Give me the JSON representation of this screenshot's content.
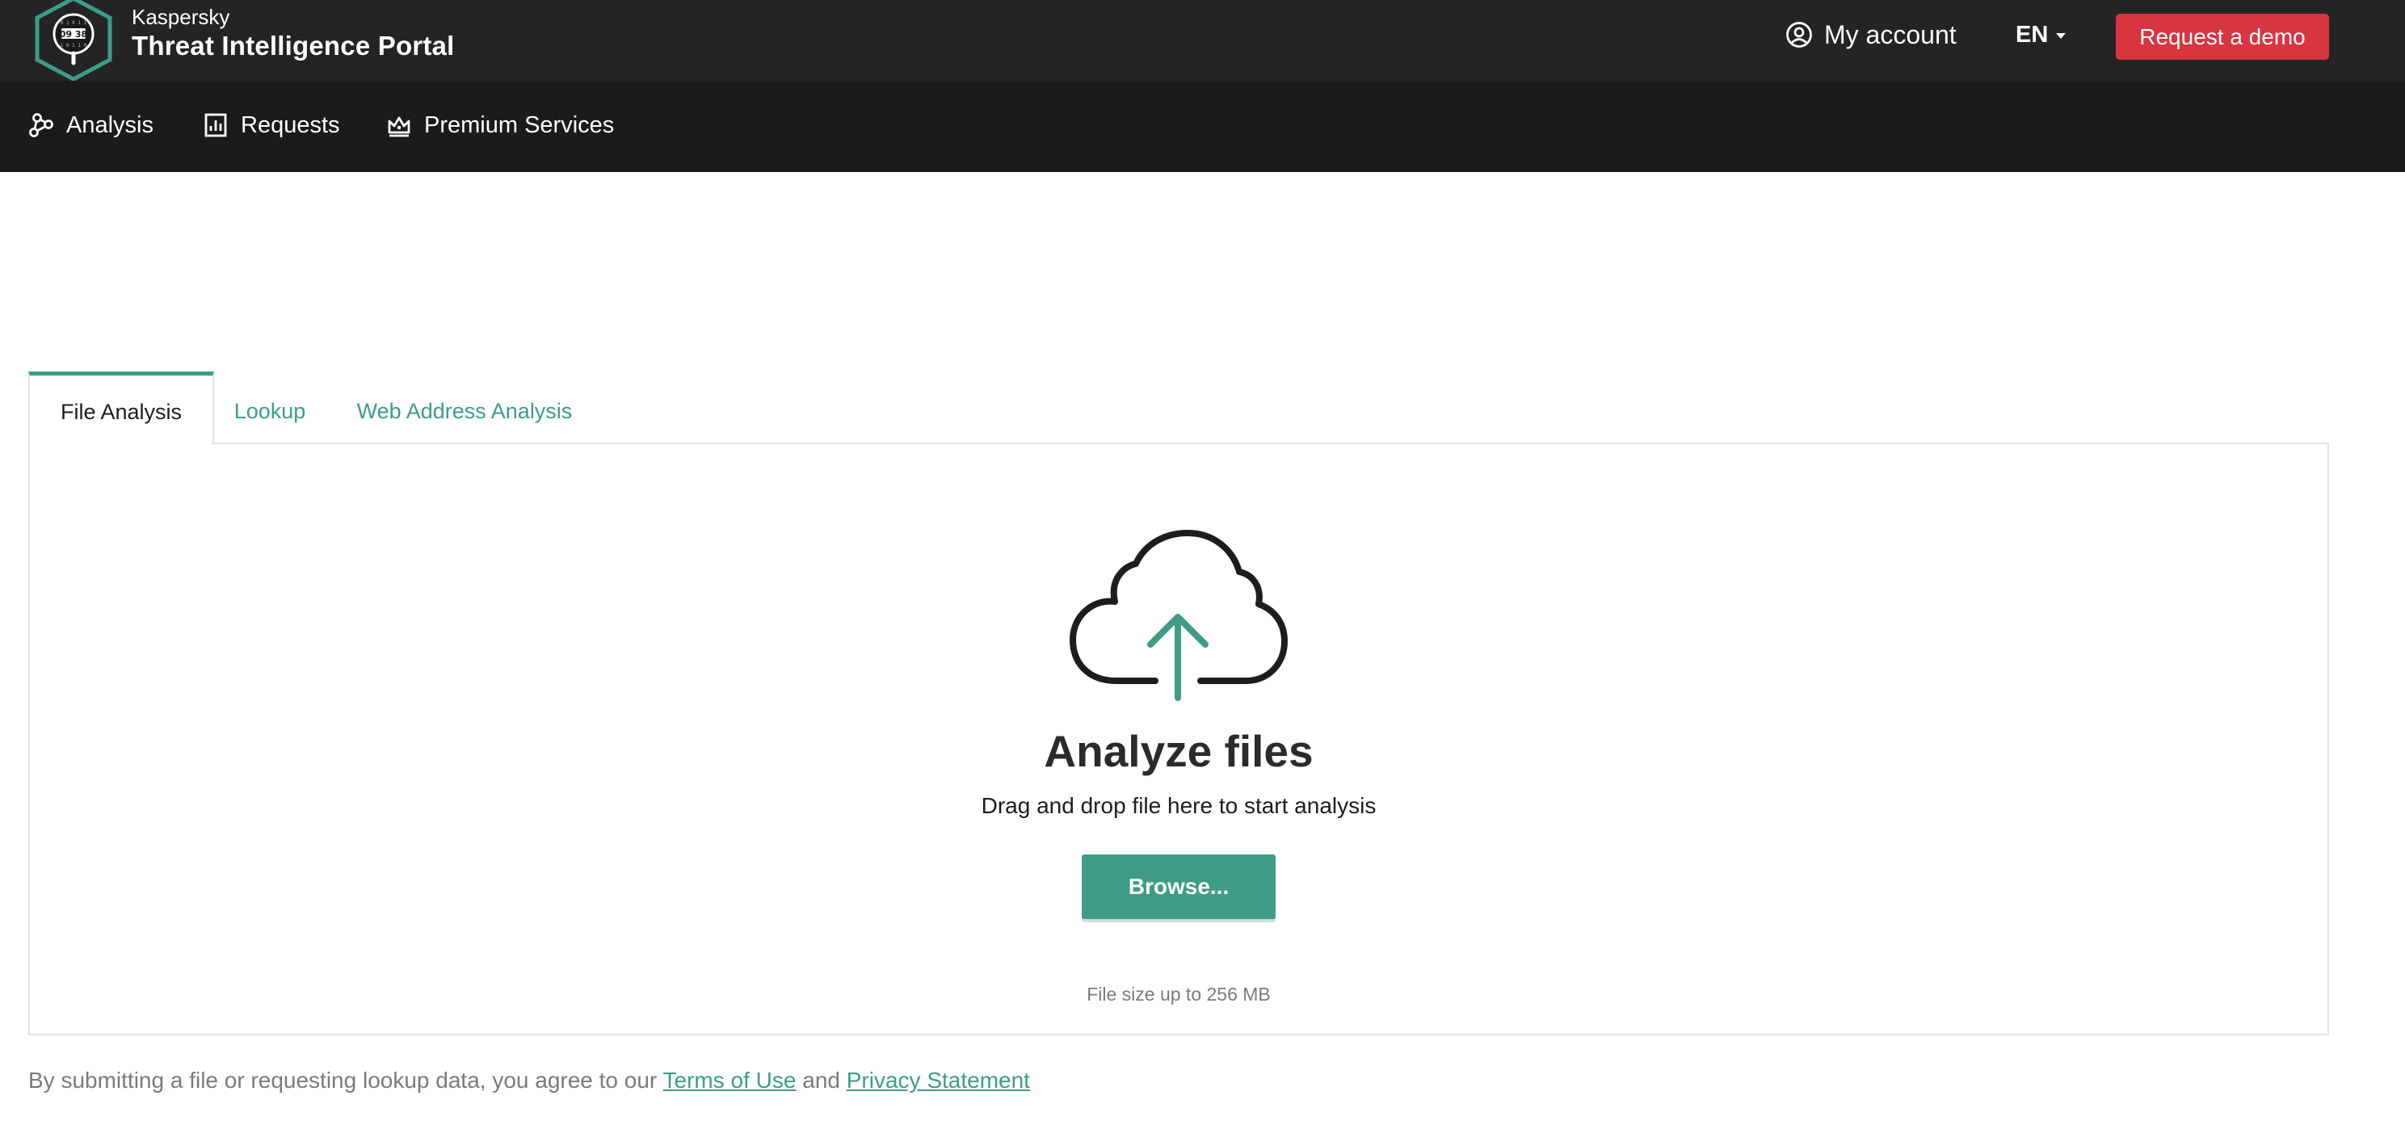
{
  "header": {
    "brand_small": "Kaspersky",
    "brand_title": "Threat Intelligence Portal",
    "account_label": "My account",
    "account_icon": "user-circle-icon",
    "language": "EN",
    "demo_button": "Request a demo"
  },
  "nav": {
    "items": [
      {
        "label": "Analysis",
        "icon": "graph-nodes-icon"
      },
      {
        "label": "Requests",
        "icon": "report-chart-icon"
      },
      {
        "label": "Premium Services",
        "icon": "crown-icon"
      }
    ]
  },
  "tabs": [
    {
      "label": "File Analysis",
      "active": true
    },
    {
      "label": "Lookup",
      "active": false
    },
    {
      "label": "Web Address Analysis",
      "active": false
    }
  ],
  "upload": {
    "icon": "cloud-upload-icon",
    "title": "Analyze files",
    "subtitle": "Drag and drop file here to start analysis",
    "browse_button": "Browse...",
    "size_note": "File size up to 256 MB"
  },
  "footer": {
    "text_before": "By submitting a file or requesting lookup data, you agree to our ",
    "terms_link": "Terms of Use",
    "text_middle": " and ",
    "privacy_link": "Privacy Statement"
  },
  "colors": {
    "accent": "#3e9c87",
    "demo_button": "#d7353f",
    "topbar": "#242424",
    "navbar": "#1b1b1b"
  }
}
